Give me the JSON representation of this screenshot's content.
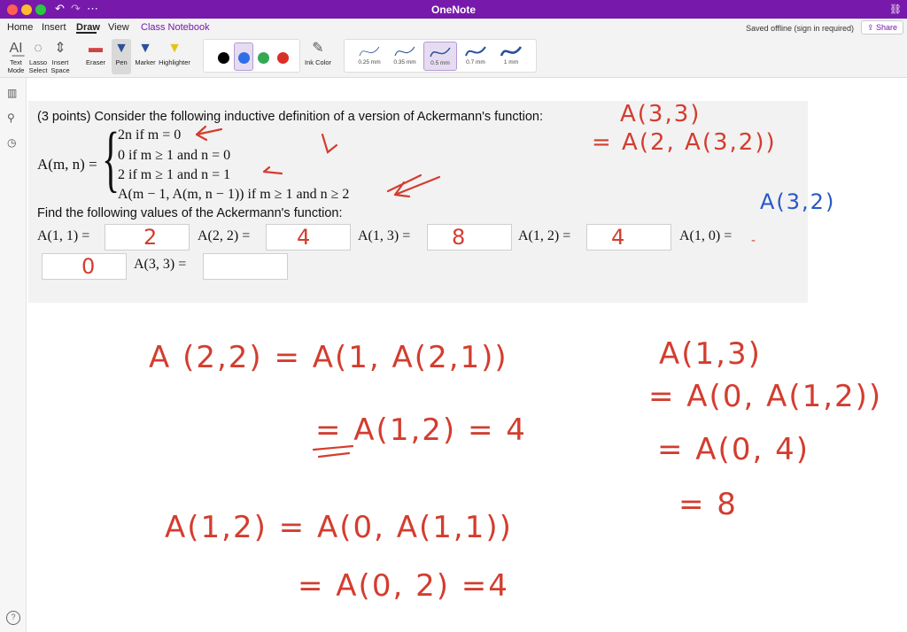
{
  "window": {
    "title": "OneNote"
  },
  "menu": {
    "items": [
      "Home",
      "Insert",
      "Draw",
      "View",
      "Class Notebook"
    ],
    "active": "Draw",
    "saved_status": "Saved offline (sign in required)",
    "share_label": "Share"
  },
  "ribbon": {
    "tools": [
      {
        "label": "Text Mode",
        "icon": "text-mode-icon"
      },
      {
        "label": "Lasso Select",
        "icon": "lasso-icon"
      },
      {
        "label": "Insert Space",
        "icon": "insert-space-icon"
      },
      {
        "label": "Eraser",
        "icon": "eraser-icon"
      },
      {
        "label": "Pen",
        "icon": "pen-icon"
      },
      {
        "label": "Marker",
        "icon": "marker-icon"
      },
      {
        "label": "Highlighter",
        "icon": "highlighter-icon"
      }
    ],
    "ink_color_label": "Ink Color",
    "colors": [
      "#000000",
      "#2f6ee6",
      "#34a853",
      "#d93025"
    ],
    "selected_color": "#2f6ee6",
    "sizes": [
      "0.25 mm",
      "0.35 mm",
      "0.5 mm",
      "0.7 mm",
      "1 mm"
    ],
    "selected_size": "0.5 mm"
  },
  "question": {
    "intro": "(3 points) Consider the following inductive definition of a version of Ackermann's function:",
    "lhs": "A(m, n) =",
    "cases": [
      "2n if m = 0",
      "0 if m ≥ 1 and n = 0",
      "2 if m ≥ 1 and n = 1",
      "A(m − 1, A(m, n − 1)) if m ≥ 1 and n ≥ 2"
    ],
    "find_text": "Find the following values of the Ackermann's function:",
    "answers": [
      {
        "label": "A(1, 1) =",
        "value": "2"
      },
      {
        "label": "A(2, 2) =",
        "value": "4"
      },
      {
        "label": "A(1, 3) =",
        "value": "8"
      },
      {
        "label": "A(1, 2) =",
        "value": "4"
      },
      {
        "label": "A(1, 0) =",
        "value": "0"
      },
      {
        "label": "A(3, 3) =",
        "value": ""
      }
    ]
  },
  "ink": {
    "top_right_1": "A(3,3)",
    "top_right_2": "= A(2, A(3,2))",
    "blue_note": "A(3,2)",
    "work1_line1": "A (2,2) = A(1, A(2,1))",
    "work1_line2": "= A(1,2)   = 4",
    "work2_line1": "A(1,2) = A(0, A(1,1))",
    "work2_line2": "= A(0, 2)   =4",
    "work3_line1": "A(1,3)",
    "work3_line2": "= A(0, A(1,2))",
    "work3_line3": "= A(0, 4)",
    "work3_line4": "= 8"
  }
}
